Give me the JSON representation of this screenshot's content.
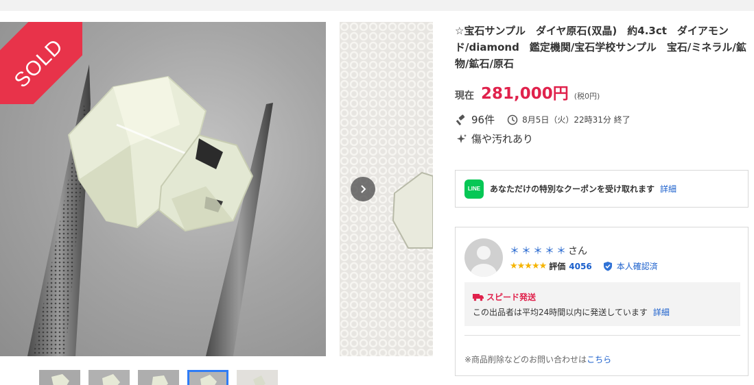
{
  "gallery": {
    "sold_badge": "SOLD",
    "thumbnail_count": 5,
    "active_thumbnail": 4
  },
  "item": {
    "title": "☆宝石サンプル　ダイヤ原石(双晶)　約4.3ct　ダイアモンド/diamond　鑑定機関/宝石学校サンプル　宝石/ミネラル/鉱物/鉱石/原石",
    "price_label": "現在",
    "price": "281,000円",
    "tax_note": "(税0円)",
    "bids": "96件",
    "end_time": "8月5日（火）22時31分 終了",
    "condition": "傷や汚れあり"
  },
  "coupon": {
    "logo_text": "LINE",
    "text": "あなただけの特別なクーポンを受け取れます",
    "link": "詳細"
  },
  "seller": {
    "name": "＊＊＊＊＊",
    "suffix": "さん",
    "stars": "★★★★★",
    "rating_label": "評価",
    "rating_count": "4056",
    "verified": "本人確認済",
    "speed_title": "スピード発送",
    "speed_desc": "この出品者は平均24時間以内に発送しています",
    "speed_link": "詳細",
    "inquiry_text": "※商品削除などのお問い合わせは",
    "inquiry_link": "こちら"
  },
  "colors": {
    "price": "#e0224c",
    "link": "#1a5fcc",
    "sold_badge": "#e8334a",
    "line_green": "#06c755",
    "star": "#f5b400"
  },
  "icons": [
    "gavel-icon",
    "clock-icon",
    "sparkle-icon",
    "chevron-right-icon",
    "line-logo",
    "verified-shield-icon",
    "truck-icon"
  ]
}
